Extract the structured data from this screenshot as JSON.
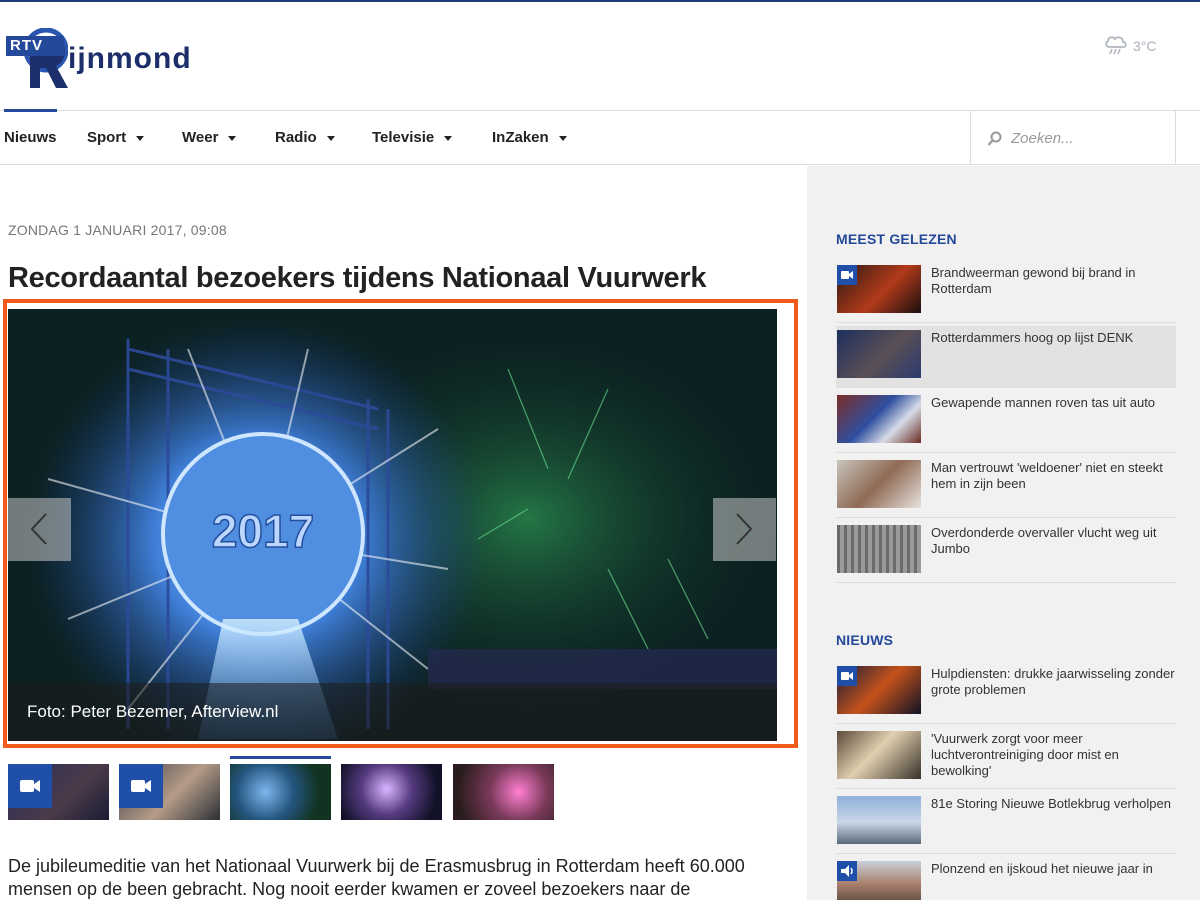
{
  "brand": {
    "rtv": "RTV",
    "name": "ijnmond",
    "logo_letter": "R"
  },
  "weather": {
    "icon": "rain-cloud-icon",
    "temperature": "3°C"
  },
  "nav": {
    "items": [
      {
        "label": "Nieuws",
        "dropdown": false,
        "active": true
      },
      {
        "label": "Sport",
        "dropdown": true
      },
      {
        "label": "Weer",
        "dropdown": true
      },
      {
        "label": "Radio",
        "dropdown": true
      },
      {
        "label": "Televisie",
        "dropdown": true
      },
      {
        "label": "InZaken",
        "dropdown": true
      }
    ],
    "search_placeholder": "Zoeken..."
  },
  "article": {
    "date": "ZONDAG 1 JANUARI 2017, 09:08",
    "title": "Recordaantal bezoekers tijdens Nationaal Vuurwerk",
    "photo_caption": "Foto: Peter Bezemer, Afterview.nl",
    "hero_overlay_text": "2017",
    "body": "De jubileumeditie van het Nationaal Vuurwerk bij de Erasmusbrug in Rotterdam heeft 60.000 mensen op de been gebracht. Nog nooit eerder kwamen er zoveel bezoekers naar de"
  },
  "gallery": {
    "thumbs": [
      {
        "type": "video",
        "active": false
      },
      {
        "type": "video",
        "active": false
      },
      {
        "type": "photo",
        "active": true
      },
      {
        "type": "photo",
        "active": false
      },
      {
        "type": "photo",
        "active": false
      }
    ]
  },
  "sidebar": {
    "meest_gelezen": {
      "heading": "MEEST GELEZEN",
      "items": [
        {
          "text": "Brandweerman gewond bij brand in Rotterdam",
          "badge": "video"
        },
        {
          "text": "Rotterdammers hoog op lijst DENK",
          "highlighted": true
        },
        {
          "text": "Gewapende mannen roven tas uit auto"
        },
        {
          "text": "Man vertrouwt 'weldoener' niet en steekt hem in zijn been"
        },
        {
          "text": "Overdonderde overvaller vlucht weg uit Jumbo"
        }
      ]
    },
    "nieuws": {
      "heading": "NIEUWS",
      "items": [
        {
          "text": "Hulpdiensten: drukke jaarwisseling zonder grote problemen",
          "badge": "video"
        },
        {
          "text": "'Vuurwerk zorgt voor meer luchtverontreiniging door mist en bewolking'"
        },
        {
          "text": "81e Storing Nieuwe Botlekbrug verholpen"
        },
        {
          "text": "Plonzend en ijskoud het nieuwe jaar in",
          "badge": "audio"
        }
      ]
    }
  }
}
